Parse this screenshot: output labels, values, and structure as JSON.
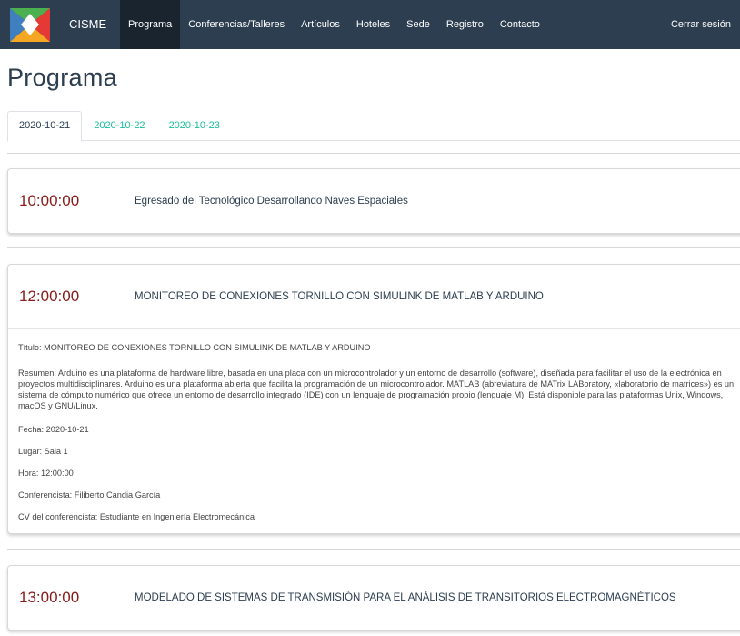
{
  "navbar": {
    "brand": "CISME",
    "items": [
      "Programa",
      "Conferencias/Talleres",
      "Artículos",
      "Hoteles",
      "Sede",
      "Registro",
      "Contacto"
    ],
    "logout": "Cerrar sesión",
    "colors": {
      "background": "#2c3e50",
      "active": "#1a242f"
    }
  },
  "page": {
    "title": "Programa"
  },
  "tabs": [
    "2020-10-21",
    "2020-10-22",
    "2020-10-23"
  ],
  "sessions": [
    {
      "time": "10:00:00",
      "title": "Egresado del Tecnológico Desarrollando Naves Espaciales"
    },
    {
      "time": "12:00:00",
      "title": "MONITOREO DE CONEXIONES TORNILLO CON SIMULINK DE MATLAB Y ARDUINO",
      "details": {
        "titulo": "Título: MONITOREO DE CONEXIONES TORNILLO CON SIMULINK DE MATLAB Y ARDUINO",
        "resumen": "Resumen: Arduino es una plataforma de hardware libre, basada en una placa con un microcontrolador y un entorno de desarrollo (software), diseñada para facilitar el uso de la electrónica en proyectos multidisciplinares. Arduino es una plataforma abierta que facilita la programación de un microcontrolador. MATLAB (abreviatura de MATrix LABoratory, «laboratorio de matrices») es un sistema de cómputo numérico que ofrece un entorno de desarrollo integrado (IDE) con un lenguaje de programación propio (lenguaje M). Está disponible para las plataformas Unix, Windows, macOS y GNU/Linux.",
        "fecha": "Fecha: 2020-10-21",
        "lugar": "Lugar: Sala 1",
        "hora": "Hora: 12:00:00",
        "conferencista": "Conferencista: Filiberto Candia García",
        "cv": "CV del conferencista: Estudiante en Ingeniería Electromecánica"
      }
    },
    {
      "time": "13:00:00",
      "title": "MODELADO DE SISTEMAS DE TRANSMISIÓN PARA EL ANÁLISIS DE TRANSITORIOS ELECTROMAGNÉTICOS"
    }
  ],
  "colors": {
    "time": "#8b1a1a",
    "tab_link": "#18bc9c",
    "title": "#2c3e50"
  }
}
